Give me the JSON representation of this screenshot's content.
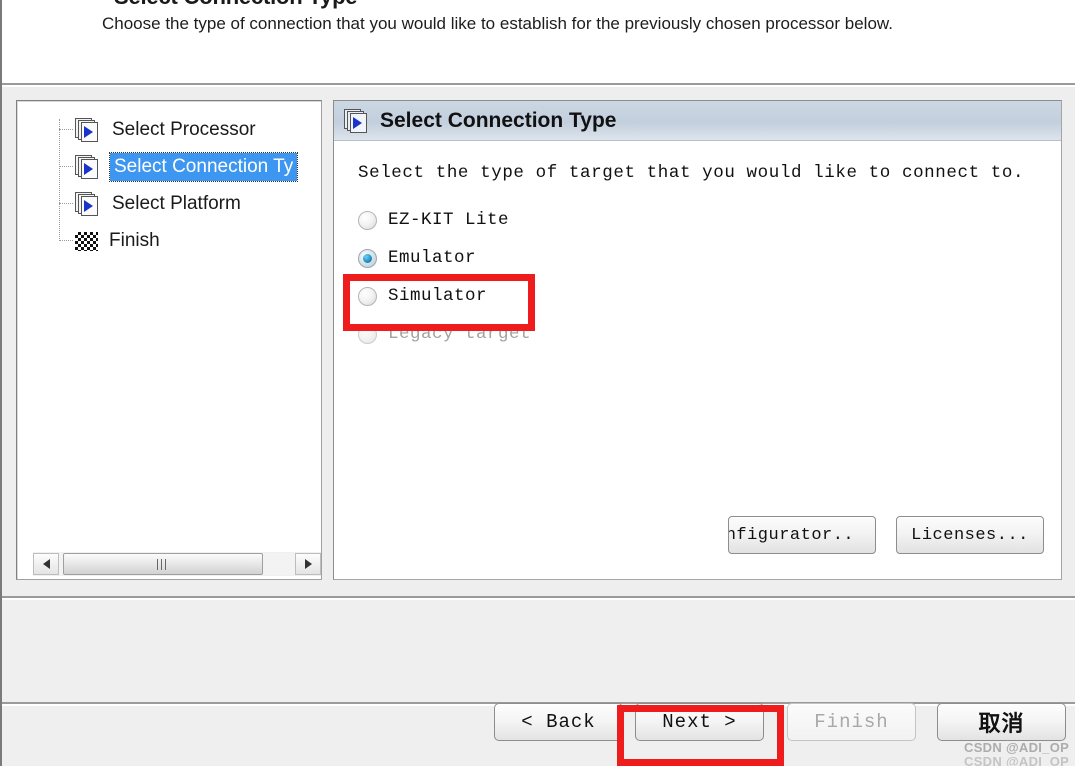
{
  "header": {
    "title": "Select Connection Type",
    "subtitle": "Choose the type of connection that you would like to establish for the previously chosen processor below."
  },
  "tree": {
    "items": [
      {
        "label": "Select Processor",
        "icon": "page-arrow-icon",
        "selected": false
      },
      {
        "label": "Select Connection Ty",
        "icon": "page-arrow-icon",
        "selected": true
      },
      {
        "label": "Select Platform",
        "icon": "page-arrow-icon",
        "selected": false
      },
      {
        "label": "Finish",
        "icon": "checkered-flag-icon",
        "selected": false
      }
    ],
    "scrollbar": {
      "left_arrow": "scroll-left-arrow-icon",
      "right_arrow": "scroll-right-arrow-icon"
    }
  },
  "panel": {
    "title": "Select Connection Type",
    "icon": "page-arrow-icon",
    "intro": "Select the type of target that you would like to connect to.",
    "options": [
      {
        "label": "EZ-KIT Lite",
        "checked": false,
        "disabled": false
      },
      {
        "label": "Emulator",
        "checked": true,
        "disabled": false
      },
      {
        "label": "Simulator",
        "checked": false,
        "disabled": false
      },
      {
        "label": "Legacy target",
        "checked": false,
        "disabled": true
      }
    ],
    "buttons": {
      "configurator": "onfigurator..",
      "licenses": "Licenses..."
    }
  },
  "footer": {
    "back": "< Back",
    "next": "Next >",
    "finish": "Finish",
    "cancel": "取消"
  },
  "watermark": {
    "line1": "CSDN @ADI_OP",
    "line2": "CSDN @ADI_OP"
  },
  "colors": {
    "accent_selection": "#3d97f0",
    "annotation_red": "#ee1c1c",
    "panel_header": "#c3cfdd",
    "radio_blue": "#1d8ec4"
  }
}
